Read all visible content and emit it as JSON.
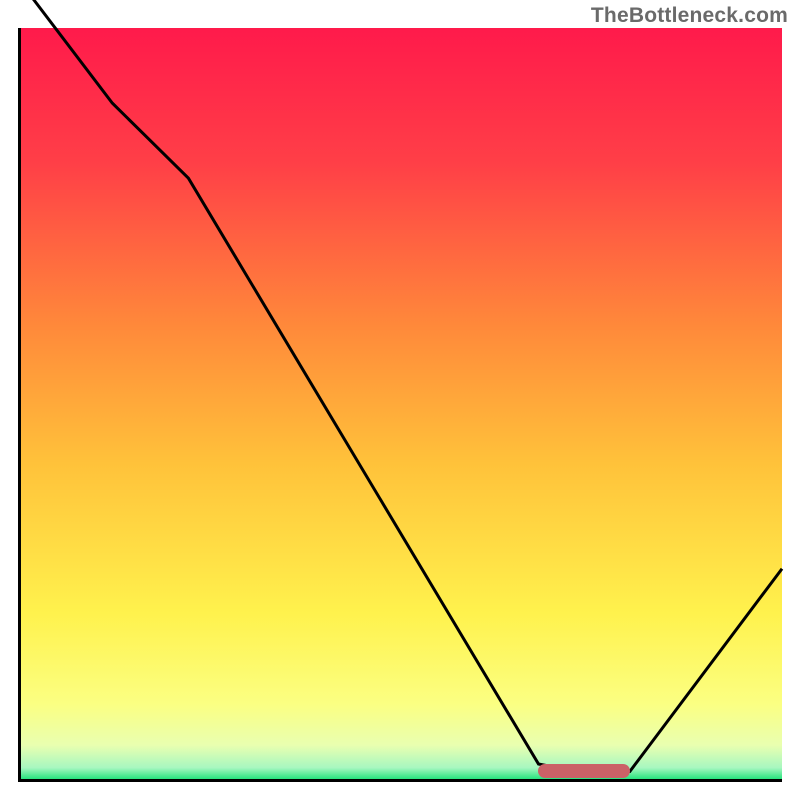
{
  "watermark": "TheBottleneck.com",
  "chart_data": {
    "type": "line",
    "title": "",
    "xlabel": "",
    "ylabel": "",
    "xlim": [
      0,
      100
    ],
    "ylim": [
      0,
      100
    ],
    "x": [
      0,
      12,
      22,
      68,
      73,
      80,
      100
    ],
    "values": [
      106,
      90,
      80,
      2,
      1,
      1,
      28
    ],
    "marker": {
      "x_start": 68,
      "x_end": 80,
      "y": 0.5
    },
    "gradient_stops": [
      {
        "pos": 0.0,
        "color": "#ff1a4b"
      },
      {
        "pos": 0.18,
        "color": "#ff3f47"
      },
      {
        "pos": 0.4,
        "color": "#ff8a3a"
      },
      {
        "pos": 0.58,
        "color": "#ffc23a"
      },
      {
        "pos": 0.78,
        "color": "#fff24d"
      },
      {
        "pos": 0.9,
        "color": "#fbff82"
      },
      {
        "pos": 0.955,
        "color": "#e9ffb0"
      },
      {
        "pos": 0.985,
        "color": "#a7f7c0"
      },
      {
        "pos": 1.0,
        "color": "#27e37e"
      }
    ]
  }
}
